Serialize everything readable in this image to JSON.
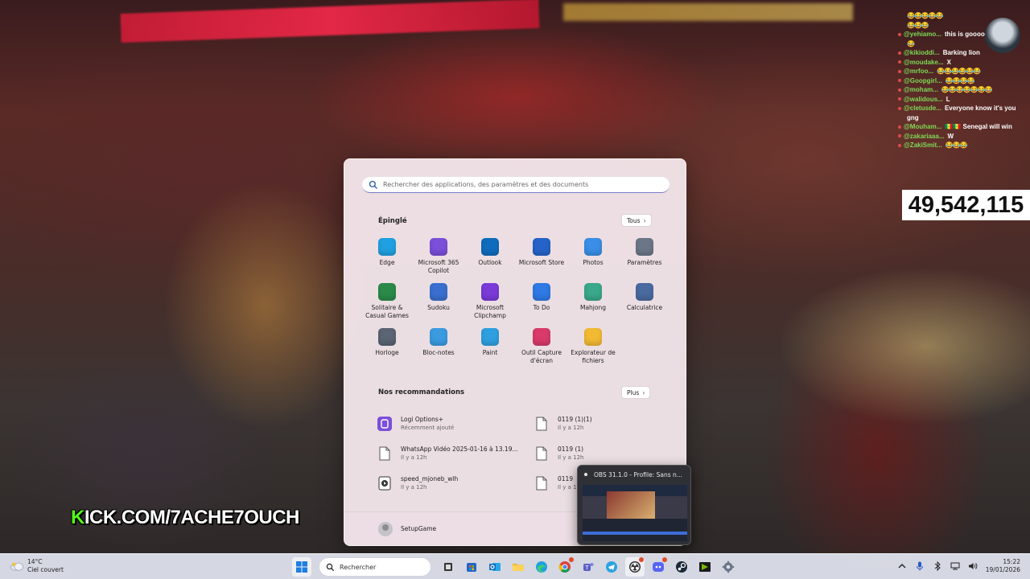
{
  "overlay": {
    "kick_k": "K",
    "kick_rest": "ICK.COM/7ACHE7OUCH",
    "viewer_count": "49,542,115"
  },
  "chat": [
    {
      "user": "",
      "msg": "😂😂😂😂😂",
      "emoji": true
    },
    {
      "user": "",
      "msg": "😂😂😂",
      "emoji": true
    },
    {
      "user": "@yehiamo...",
      "msg": "this is gooooo",
      "emoji": false
    },
    {
      "user": "",
      "msg": "😂",
      "emoji": true
    },
    {
      "user": "@kikioddi...",
      "msg": "Barking lion",
      "emoji": false
    },
    {
      "user": "@moudake...",
      "msg": "X",
      "emoji": false
    },
    {
      "user": "@mrfoo...",
      "msg": "😂😂😂😂😂😂",
      "emoji": true
    },
    {
      "user": "@Goopgirl...",
      "msg": "😂😂😂😂",
      "emoji": true
    },
    {
      "user": "@moham...",
      "msg": "😂😂😂😂😂😂😂",
      "emoji": true
    },
    {
      "user": "@walidous...",
      "msg": "L",
      "emoji": false
    },
    {
      "user": "@cletusde...",
      "msg": "Everyone know it's you",
      "emoji": false
    },
    {
      "user": "",
      "msg": "gng",
      "emoji": false
    },
    {
      "user": "@Mouham...",
      "msg": "🇸🇳🇸🇳 Senegal will win",
      "emoji": false
    },
    {
      "user": "@zakariaaa...",
      "msg": "W",
      "emoji": false
    },
    {
      "user": "@ZakiSmit...",
      "msg": "😂😂😂",
      "emoji": true
    }
  ],
  "start_menu": {
    "search_placeholder": "Rechercher des applications, des paramètres et des documents",
    "pinned_title": "Épinglé",
    "all_button": "Tous",
    "pinned": [
      {
        "label": "Edge",
        "icon": "edge-icon",
        "color": "#1fa0e0"
      },
      {
        "label": "Microsoft 365 Copilot",
        "icon": "m365-copilot-icon",
        "color": "#7b4fd8"
      },
      {
        "label": "Outlook",
        "icon": "outlook-icon",
        "color": "#0f6cbd"
      },
      {
        "label": "Microsoft Store",
        "icon": "store-icon",
        "color": "#2563c9"
      },
      {
        "label": "Photos",
        "icon": "photos-icon",
        "color": "#3a8ee6"
      },
      {
        "label": "Paramètres",
        "icon": "settings-icon",
        "color": "#6b7686"
      },
      {
        "label": "Solitaire & Casual Games",
        "icon": "solitaire-icon",
        "color": "#2b8a4a"
      },
      {
        "label": "Sudoku",
        "icon": "sudoku-icon",
        "color": "#3a6fd0"
      },
      {
        "label": "Microsoft Clipchamp",
        "icon": "clipchamp-icon",
        "color": "#7a3ad8"
      },
      {
        "label": "To Do",
        "icon": "todo-icon",
        "color": "#2f7ae5"
      },
      {
        "label": "Mahjong",
        "icon": "mahjong-icon",
        "color": "#3aa88a"
      },
      {
        "label": "Calculatrice",
        "icon": "calculator-icon",
        "color": "#4a6aa0"
      },
      {
        "label": "Horloge",
        "icon": "clock-icon",
        "color": "#5a6472"
      },
      {
        "label": "Bloc-notes",
        "icon": "notepad-icon",
        "color": "#3a9be0"
      },
      {
        "label": "Paint",
        "icon": "paint-icon",
        "color": "#2f9fe0"
      },
      {
        "label": "Outil Capture d'écran",
        "icon": "snipping-tool-icon",
        "color": "#d83a6a"
      },
      {
        "label": "Explorateur de fichiers",
        "icon": "file-explorer-icon",
        "color": "#f2b933"
      }
    ],
    "recs_title": "Nos recommandations",
    "more_button": "Plus",
    "recommendations": [
      {
        "name": "Logi Options+",
        "sub": "Récemment ajouté",
        "icon": "logi-icon"
      },
      {
        "name": "0119 (1)(1)",
        "sub": "Il y a 12h",
        "icon": "file-icon"
      },
      {
        "name": "WhatsApp Vidéo 2025-01-16 à 13.19...",
        "sub": "Il y a 12h",
        "icon": "file-icon"
      },
      {
        "name": "0119 (1)",
        "sub": "Il y a 12h",
        "icon": "file-icon"
      },
      {
        "name": "speed_mjoneb_wlh",
        "sub": "Il y a 12h",
        "icon": "video-file-icon"
      },
      {
        "name": "0119",
        "sub": "Il y a 14",
        "icon": "file-icon"
      }
    ],
    "user_name": "SetupGame"
  },
  "obs_preview": {
    "title": "OBS 31.1.0 - Profile: Sans n..."
  },
  "taskbar": {
    "weather_temp": "14°C",
    "weather_desc": "Ciel couvert",
    "search_label": "Rechercher",
    "time": "15:22",
    "date": "19/01/2026"
  }
}
